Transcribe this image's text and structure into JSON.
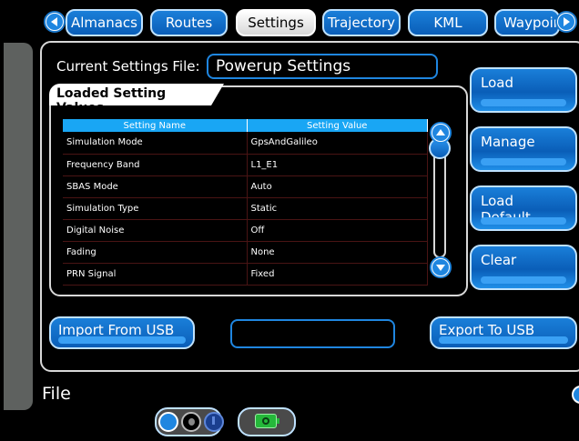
{
  "tabs": [
    {
      "label": "Almanacs",
      "active": false
    },
    {
      "label": "Routes",
      "active": false
    },
    {
      "label": "Settings",
      "active": true
    },
    {
      "label": "Trajectory",
      "active": false
    },
    {
      "label": "KML",
      "active": false
    },
    {
      "label": "Waypoin",
      "active": false
    }
  ],
  "current_file": {
    "label": "Current Settings File:",
    "value": "Powerup Settings"
  },
  "loaded": {
    "title": "Loaded Setting Values",
    "columns": [
      "Setting Name",
      "Setting Value"
    ],
    "rows": [
      {
        "name": "Simulation Mode",
        "value": "GpsAndGalileo"
      },
      {
        "name": "Frequency Band",
        "value": "L1_E1"
      },
      {
        "name": "SBAS Mode",
        "value": "Auto"
      },
      {
        "name": "Simulation Type",
        "value": "Static"
      },
      {
        "name": "Digital Noise",
        "value": "Off"
      },
      {
        "name": "Fading",
        "value": "None"
      },
      {
        "name": "PRN Signal",
        "value": "Fixed"
      }
    ]
  },
  "buttons": {
    "load": "Load",
    "manage": "Manage",
    "load_default": "Load Default",
    "clear": "Clear",
    "import_usb": "Import From USB",
    "export_usb": "Export To USB"
  },
  "usb_field": {
    "value": ""
  },
  "footer": {
    "title": "File"
  },
  "icons": {
    "scroll_up": "chevron-up-icon",
    "scroll_down": "chevron-down-icon",
    "battery": "battery-icon"
  },
  "colors": {
    "accent": "#1f86e0",
    "table_header": "#19a6f4",
    "battery": "#25b83a"
  }
}
